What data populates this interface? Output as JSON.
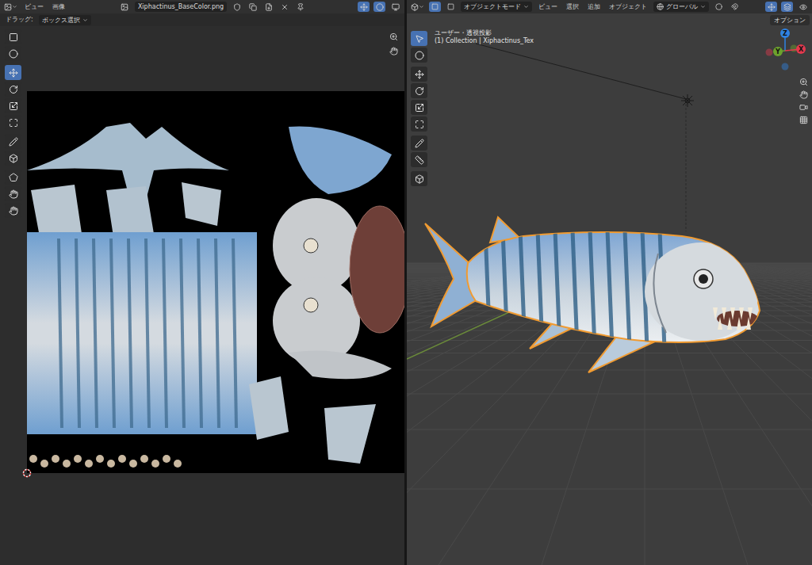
{
  "image_editor": {
    "menus": [
      "ビュー",
      "画像"
    ],
    "image_name": "Xiphactinus_BaseColor.png",
    "header_toggles": [
      {
        "selected": true
      },
      {
        "selected": true
      },
      {
        "selected": false
      }
    ],
    "tool_settings": {
      "label": "ドラッグ:",
      "value": "ボックス選択"
    },
    "tools": [
      {
        "selected": false
      },
      {
        "selected": false
      },
      {
        "selected": true
      },
      {
        "selected": false
      },
      {
        "selected": false
      },
      {
        "selected": false
      },
      {
        "selected": false
      },
      {
        "selected": false
      },
      {
        "selected": false
      },
      {
        "selected": false
      },
      {
        "selected": false
      }
    ]
  },
  "viewport": {
    "mode": "オブジェクトモード",
    "menus": [
      "ビュー",
      "選択",
      "追加",
      "オブジェクト"
    ],
    "transform_orientation": "グローバル",
    "header_toggles": [
      {
        "selected": true
      },
      {
        "selected": true
      },
      {
        "selected": false
      }
    ],
    "options": "オプション",
    "view_info": [
      "ユーザー・透視投影",
      "(1) Collection | Xiphactinus_Tex"
    ],
    "tools": [
      {
        "selected": true
      },
      {
        "selected": false
      },
      {
        "selected": false
      },
      {
        "selected": false
      },
      {
        "selected": false
      },
      {
        "selected": false
      },
      {
        "selected": false
      },
      {
        "selected": false
      },
      {
        "selected": false
      }
    ],
    "gizmo_axes": [
      {
        "label": "Z",
        "color": "#2f83e3"
      },
      {
        "label": "Y",
        "color": "#6ca22d"
      },
      {
        "label": "X",
        "color": "#e2394d"
      }
    ],
    "object": {
      "selected": true
    }
  }
}
